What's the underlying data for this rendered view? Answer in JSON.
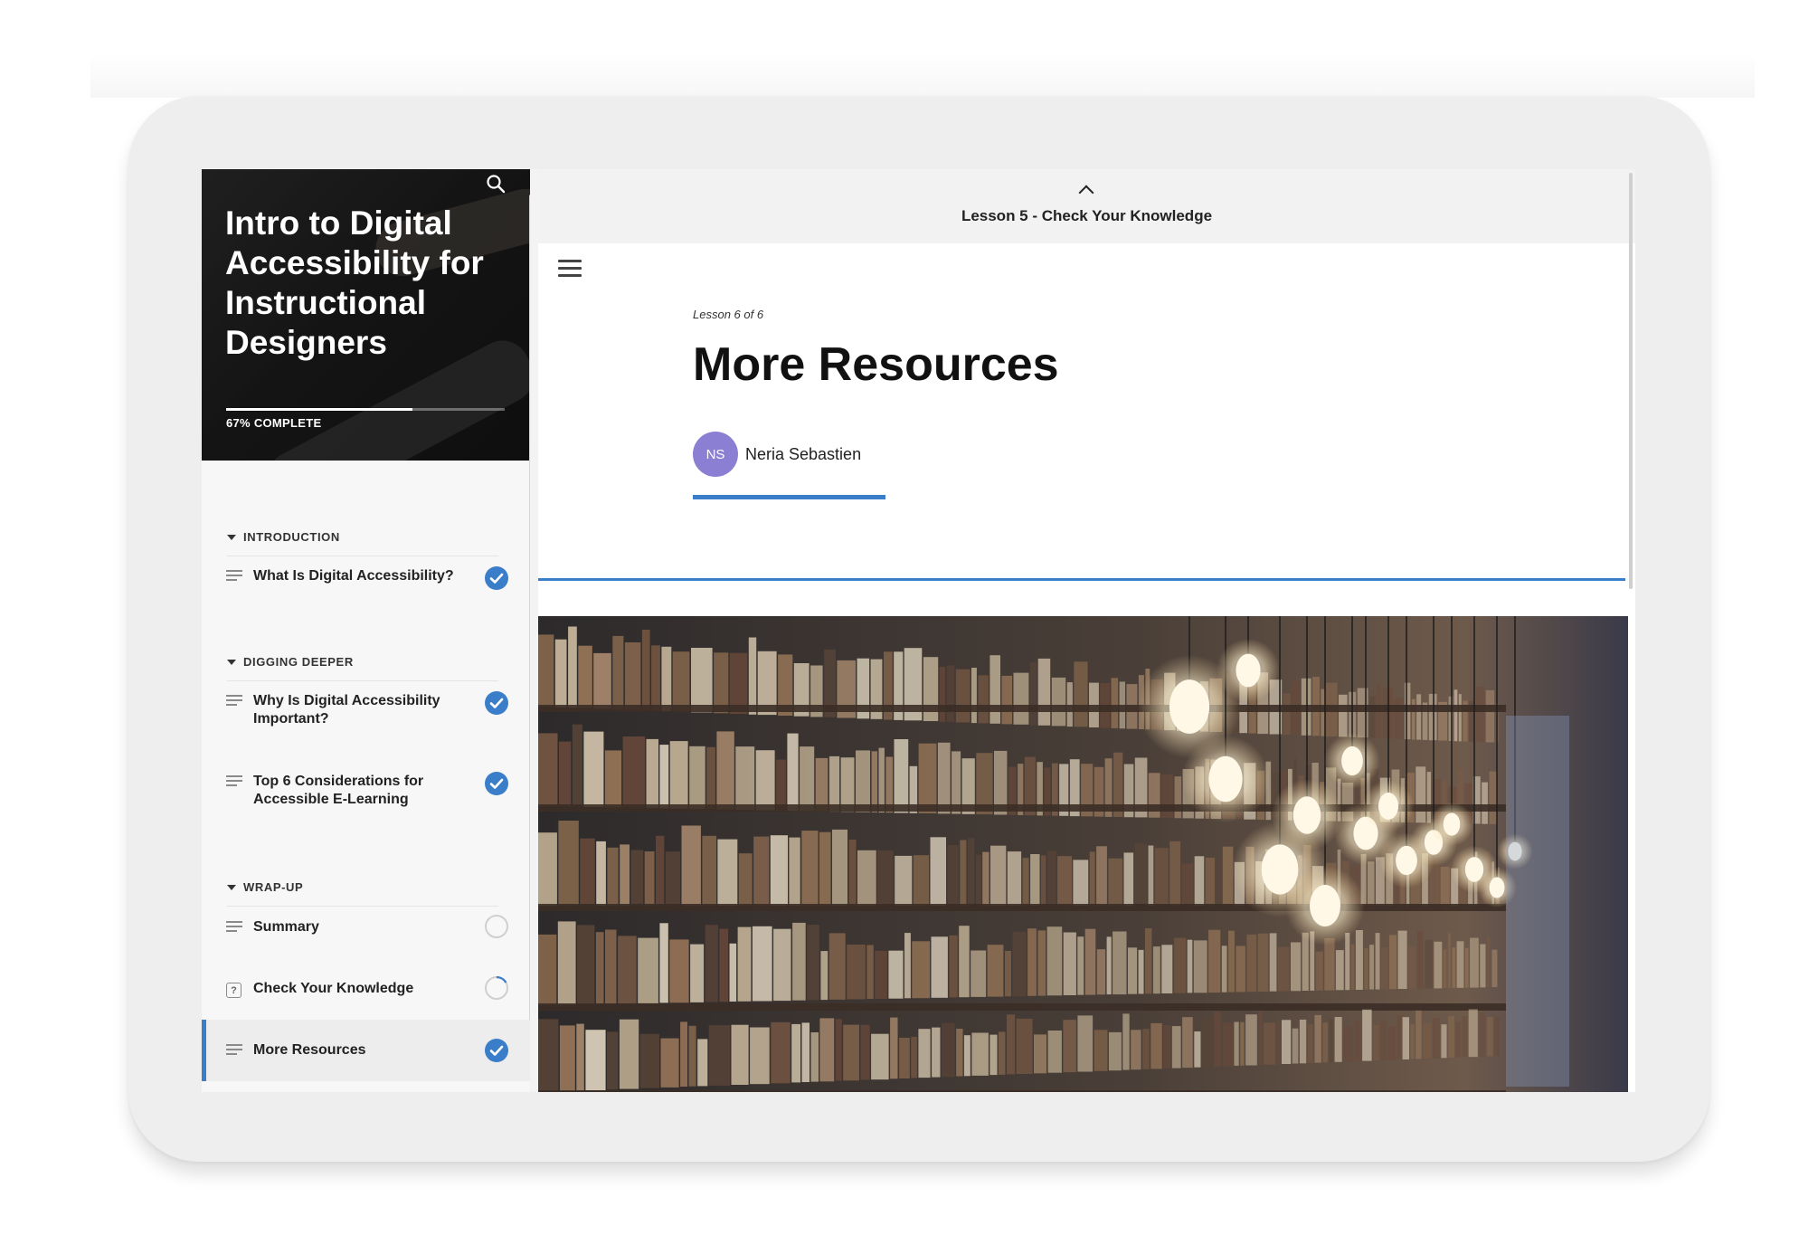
{
  "course": {
    "title": "Intro to Digital Accessibility for Instructional Designers",
    "progress_label": "67% COMPLETE",
    "progress_fraction": 0.67
  },
  "sidebar": {
    "sections": [
      {
        "label": "INTRODUCTION"
      },
      {
        "label": "DIGGING DEEPER"
      },
      {
        "label": "WRAP-UP"
      }
    ],
    "lessons": [
      {
        "label": "What Is Digital Accessibility?",
        "icon": "lines-icon",
        "status": "complete"
      },
      {
        "label": "Why Is Digital Accessibility Important?",
        "icon": "lines-icon",
        "status": "complete"
      },
      {
        "label": "Top 6 Considerations for Accessible E-Learning",
        "icon": "lines-icon",
        "status": "complete"
      },
      {
        "label": "Summary",
        "icon": "lines-icon",
        "status": "not-started"
      },
      {
        "label": "Check Your Knowledge",
        "icon": "question-box-icon",
        "status": "in-progress"
      },
      {
        "label": "More Resources",
        "icon": "lines-icon",
        "status": "complete",
        "active": true
      }
    ]
  },
  "main": {
    "previous_lesson": "Lesson 5 - Check Your Knowledge",
    "lesson_count": "Lesson 6 of 6",
    "lesson_title": "More Resources",
    "author": {
      "initials": "NS",
      "name": "Neria Sebastien"
    }
  },
  "colors": {
    "accent": "#3a7dc9",
    "avatar": "#8b7fd4",
    "check": "#3a7dc9"
  }
}
